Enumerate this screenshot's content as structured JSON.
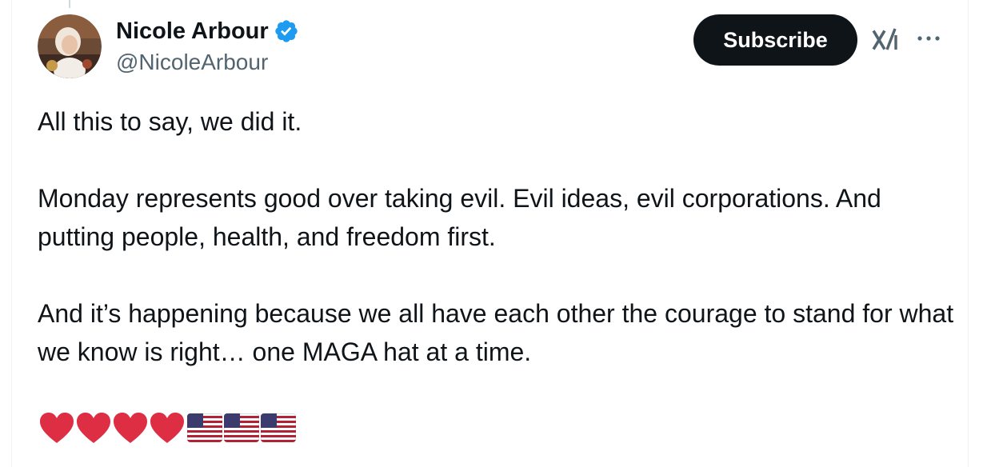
{
  "post": {
    "author": {
      "name": "Nicole Arbour",
      "handle": "@NicoleArbour",
      "verified_icon": "verified-badge-icon",
      "verified_color": "#1d9bf0"
    },
    "actions": {
      "subscribe_label": "Subscribe",
      "grok_icon": "grok-icon",
      "more_icon": "more-options-icon"
    },
    "body": {
      "paragraphs": [
        "All this to say, we did it.",
        "Monday represents good over taking evil. Evil ideas, evil corporations. And putting people, health, and freedom first.",
        "And it’s happening because we all have each other the courage to stand for what we know is right… one MAGA hat at a time."
      ],
      "emojis": [
        "red-heart",
        "red-heart",
        "red-heart",
        "red-heart",
        "us-flag",
        "us-flag",
        "us-flag"
      ]
    }
  },
  "colors": {
    "text_primary": "#0f1419",
    "text_secondary": "#536471",
    "button_bg": "#0f1419",
    "button_text": "#ffffff",
    "heart": "#e0245e"
  }
}
